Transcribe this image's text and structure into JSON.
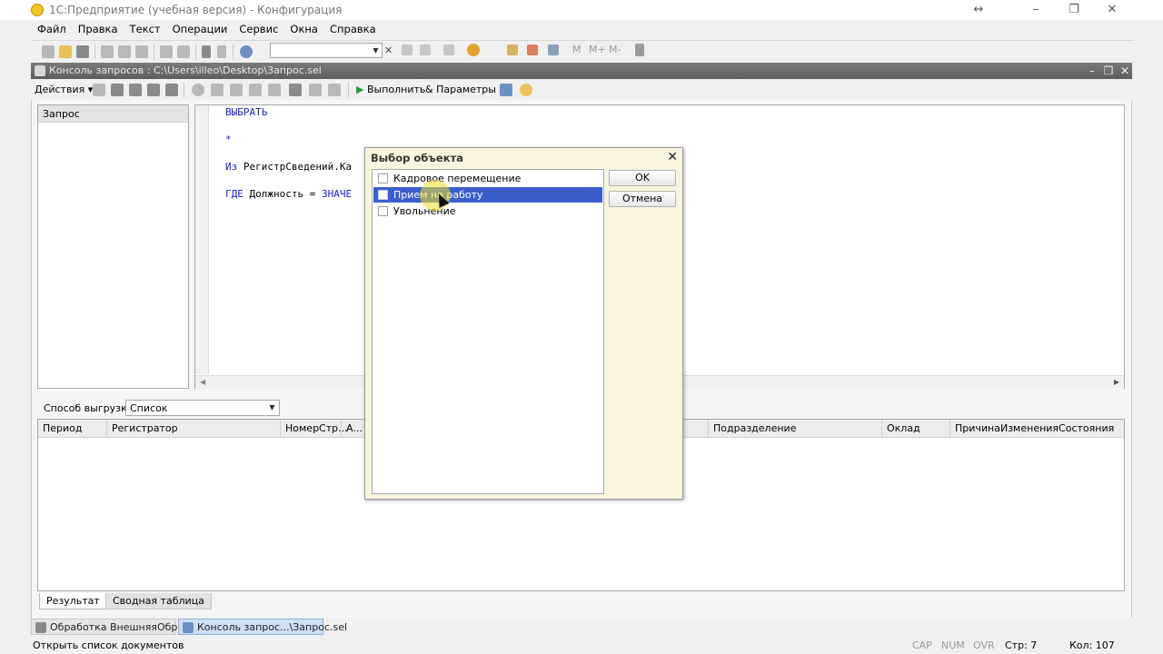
{
  "app": {
    "title": "1С:Предприятие (учебная версия) - Конфигурация",
    "icon": "1c-app-icon"
  },
  "window_controls": {
    "restore_arrows": "↔",
    "minimize": "–",
    "maximize": "❐",
    "close": "✕"
  },
  "menu": [
    "Файл",
    "Правка",
    "Текст",
    "Операции",
    "Сервис",
    "Окна",
    "Справка"
  ],
  "toolbar": {
    "search_value": "",
    "m_buttons": [
      "M",
      "M+",
      "M-"
    ]
  },
  "child_window": {
    "title": "Консоль запросов : C:\\Users\\illeo\\Desktop\\Запрос.sel"
  },
  "console_toolbar": {
    "actions_label": "Действия",
    "run_label": "Выполнить",
    "params_label": "Параметры"
  },
  "left_panel": {
    "header": "Запрос"
  },
  "query_text": {
    "line1": "ВЫБРАТЬ",
    "line2": "*",
    "line3_kw": "Из",
    "line3_rest": " РегистрСведений.Ка",
    "line4_kw": "ГДЕ",
    "line4_rest": " Должность = ",
    "line4_kw2": "ЗНАЧЕ"
  },
  "export": {
    "label": "Способ выгрузки:",
    "value": "Список"
  },
  "grid": {
    "columns": [
      "Период",
      "Регистратор",
      "НомерСтр...",
      "А...",
      "Подразделение",
      "Оклад",
      "ПричинаИзмененияСостояния"
    ]
  },
  "bottom_tabs": [
    "Результат",
    "Сводная таблица"
  ],
  "taskbar": [
    "Обработка  ВнешняяОбраб...",
    "Консоль запрос...\\Запрос.sel"
  ],
  "status": {
    "text": "Открыть список документов",
    "cap": "CAP",
    "num": "NUM",
    "ovr": "OVR",
    "line": "Стр: 7",
    "col": "Кол: 107"
  },
  "dialog": {
    "title": "Выбор объекта",
    "items": [
      "Кадровое перемещение",
      "Прием на работу",
      "Увольнение"
    ],
    "selected_index": 1,
    "ok_label": "OK",
    "cancel_label": "Отмена"
  },
  "colors": {
    "selection": "#3a5fcd",
    "keyword": "#2020d0",
    "dialog_bg": "#f9f4df",
    "run_green": "#2a9a3a"
  }
}
